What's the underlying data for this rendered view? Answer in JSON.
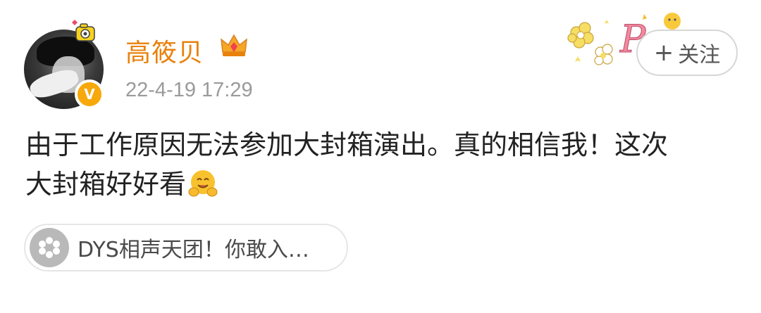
{
  "user": {
    "name": "高筱贝",
    "time": "22-4-19 17:29",
    "verified_badge": "V"
  },
  "follow_button": {
    "plus": "+",
    "label": "关注"
  },
  "post": {
    "lines": [
      "由于工作原因无法参加大封箱演出。真的相信我！这次",
      "大封箱好好看"
    ]
  },
  "topic": {
    "label": "DYS相声天团！你敢入…"
  },
  "colors": {
    "name": "#e8810d",
    "time": "#9a9a9a",
    "badge": "#f7a80a",
    "text": "#222222"
  },
  "icons": [
    "crown-icon",
    "hug-emoji-icon",
    "flower-icon",
    "topic-icon",
    "verified-badge"
  ]
}
